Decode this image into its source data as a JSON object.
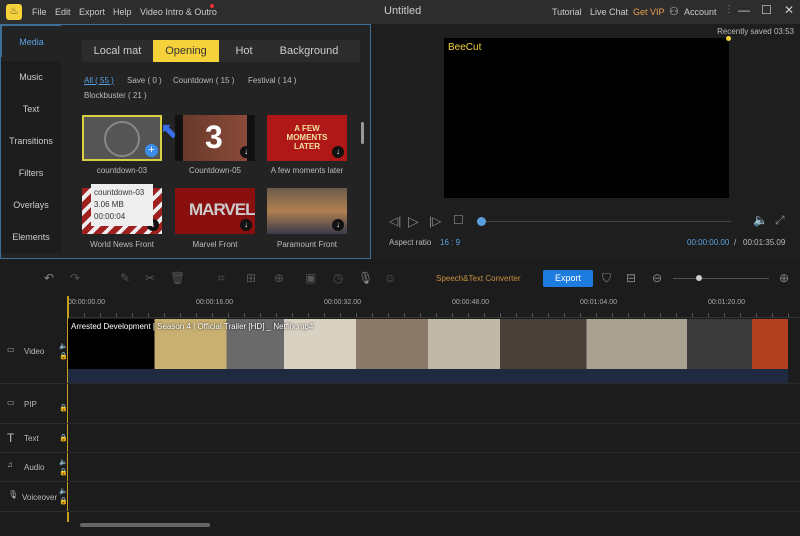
{
  "titlebar": {
    "title": "Untitled",
    "menu": [
      "File",
      "Edit",
      "Export",
      "Help",
      "Video Intro & Outro"
    ],
    "right": {
      "tutorial": "Tutorial",
      "live_chat": "Live Chat",
      "get_vip": "Get VIP",
      "account": "Account"
    }
  },
  "sidebar": {
    "tabs": [
      "Media",
      "Music",
      "Text",
      "Transitions",
      "Filters",
      "Overlays",
      "Elements"
    ]
  },
  "library": {
    "tabs": [
      "Local mat",
      "Opening",
      "Hot",
      "Background"
    ],
    "active_tab": "Opening",
    "filters": [
      "All ( 55 )",
      "Save ( 0 )",
      "Countdown ( 15 )",
      "Festival ( 14 )",
      "Blockbuster ( 21 )"
    ],
    "items": [
      {
        "label": "countdown-03"
      },
      {
        "label": "Countdown-05",
        "text": "3"
      },
      {
        "label": "A few moments later",
        "text": "A FEW MOMENTS LATER"
      },
      {
        "label": "World News Front"
      },
      {
        "label": "Marvel Front",
        "text": "MARVEL"
      },
      {
        "label": "Paramount Front"
      }
    ],
    "tooltip": {
      "name": "countdown-03",
      "size": "3.06 MB",
      "duration": "00:00:04"
    }
  },
  "preview": {
    "saved": "Recently saved 03:53",
    "watermark": "BeeCut",
    "aspect_label": "Aspect ratio",
    "aspect_value": "16 : 9",
    "current_time": "00:00:00.00",
    "separator": "/",
    "total_time": "00:01:35.09",
    "progress": 0
  },
  "toolbar": {
    "speech_text": "Speech&Text Converter",
    "export": "Export"
  },
  "timeline": {
    "ruler": [
      "00:00:00.00",
      "00:00:16.00",
      "00:00:32.00",
      "00:00:48.00",
      "00:01:04.00",
      "00:01:20.00"
    ],
    "clip": "Arrested Development | Season 4 | Official Trailer [HD] _ Netflix.mp4",
    "tracks": [
      "Video",
      "PIP",
      "Text",
      "Audio",
      "Voiceover"
    ]
  },
  "colors": {
    "accent": "#f5d23a",
    "blue": "#1e7be0"
  }
}
